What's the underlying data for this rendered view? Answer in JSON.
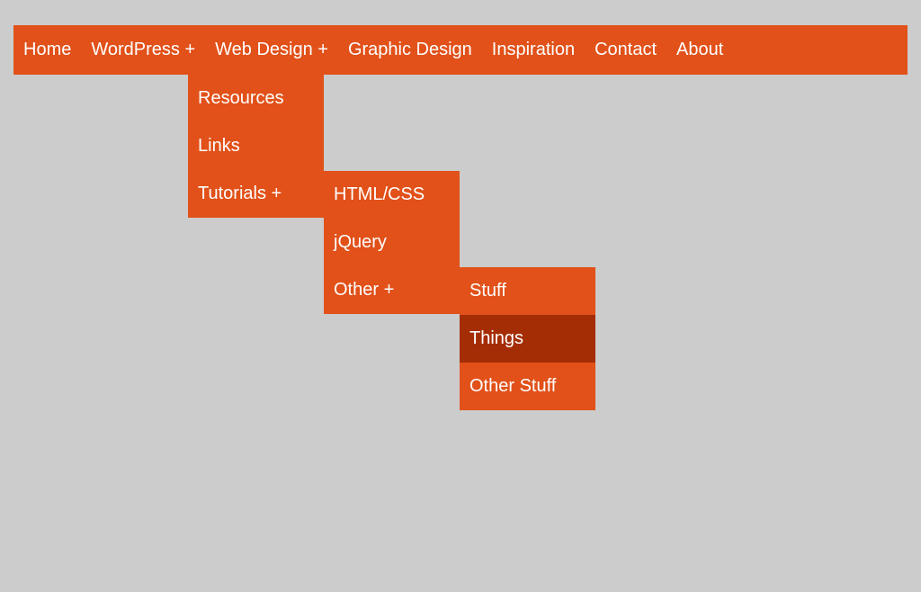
{
  "nav": {
    "items": [
      {
        "label": "Home"
      },
      {
        "label": "WordPress +"
      },
      {
        "label": "Web Design +"
      },
      {
        "label": "Graphic Design"
      },
      {
        "label": "Inspiration"
      },
      {
        "label": "Contact"
      },
      {
        "label": "About"
      }
    ]
  },
  "webdesign": {
    "items": [
      {
        "label": "Resources"
      },
      {
        "label": "Links"
      },
      {
        "label": "Tutorials +"
      }
    ]
  },
  "tutorials": {
    "items": [
      {
        "label": "HTML/CSS"
      },
      {
        "label": "jQuery"
      },
      {
        "label": "Other +"
      }
    ]
  },
  "other": {
    "items": [
      {
        "label": "Stuff"
      },
      {
        "label": "Things"
      },
      {
        "label": "Other Stuff"
      }
    ]
  }
}
